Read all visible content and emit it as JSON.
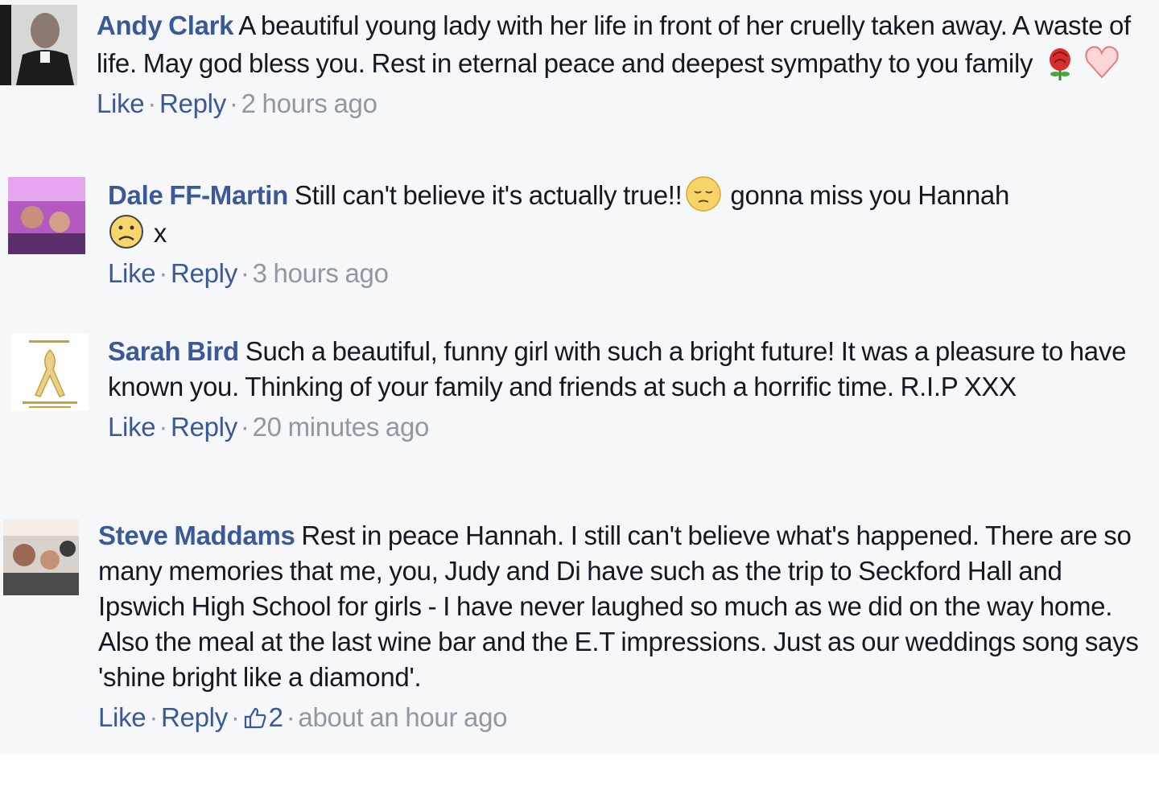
{
  "comments": [
    {
      "author": "Andy Clark",
      "text_parts": [
        "A beautiful young lady with her life in front of her cruelly taken away. A waste of life. May god bless you. Rest in eternal peace and deepest sympathy to you family"
      ],
      "emojis": [
        "rose-icon",
        "heart-icon"
      ],
      "like_label": "Like",
      "reply_label": "Reply",
      "separator": "·",
      "time": "2 hours ago"
    },
    {
      "author": "Dale FF-Martin",
      "text_parts": [
        "Still can't believe it's actually true!!",
        "gonna miss you Hannah",
        "x"
      ],
      "emojis": [
        "pensive-face-icon",
        "sad-face-icon"
      ],
      "like_label": "Like",
      "reply_label": "Reply",
      "separator": "·",
      "time": "3 hours ago"
    },
    {
      "author": "Sarah Bird",
      "text_parts": [
        "Such a beautiful, funny girl with such a bright future! It was a pleasure to have known you. Thinking of your family and friends at such a horrific time. R.I.P XXX"
      ],
      "emojis": [],
      "like_label": "Like",
      "reply_label": "Reply",
      "separator": "·",
      "time": "20 minutes ago"
    },
    {
      "author": "Steve Maddams",
      "text_parts": [
        "Rest in peace Hannah. I still can't believe what's happened. There are so many memories that me, you, Judy and Di have such as the trip to Seckford Hall and Ipswich High School for girls - I have never laughed so much as we did on the way home. Also the meal at the last wine bar and the E.T impressions. Just as our weddings song says 'shine bright like a diamond'."
      ],
      "emojis": [],
      "like_label": "Like",
      "reply_label": "Reply",
      "separator": "·",
      "like_count": "2",
      "like_icon": "thumbs-up-icon",
      "time": "about an hour ago"
    }
  ],
  "colors": {
    "author": "#3b5998",
    "link": "#3b5998",
    "muted": "#9197a3",
    "text": "#141823",
    "panel_background": "#f6f7f9"
  }
}
